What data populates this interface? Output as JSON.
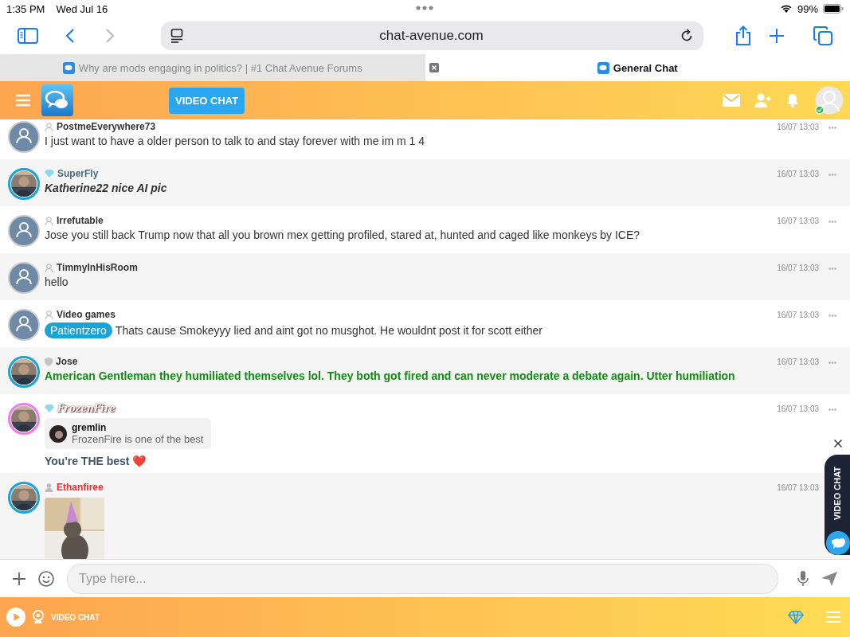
{
  "status_bar": {
    "time": "1:35 PM",
    "date": "Wed Jul 16",
    "battery": "99%"
  },
  "browser": {
    "address": "chat-avenue.com",
    "tabs": [
      {
        "title": "Why are mods engaging in politics? | #1 Chat Avenue Forums",
        "selected": false
      },
      {
        "title": "General Chat",
        "selected": true
      }
    ]
  },
  "header": {
    "video_button": "VIDEO CHAT"
  },
  "messages": [
    {
      "badge": {
        "kind": "user"
      },
      "author": {
        "name": "PostmeEverywhere73",
        "kind": "plain"
      },
      "avatar": {
        "kind": "default"
      },
      "body": {
        "kind": "plain",
        "text": "I just want to have a older person to talk to and stay forever with me im m 1 4"
      },
      "time": "16/07 13:03"
    },
    {
      "badge": {
        "kind": "diamond"
      },
      "author": {
        "name": "SuperFly",
        "kind": "accent"
      },
      "body": {
        "kind": "italic",
        "text": "Katherine22 nice AI pic"
      },
      "time": "16/07 13:03"
    },
    {
      "badge": {
        "kind": "user"
      },
      "author": {
        "name": "Irrefutable",
        "kind": "plain"
      },
      "avatar": {
        "kind": "default"
      },
      "body": {
        "kind": "plain",
        "text": "Jose you still back Trump now that all you brown mex getting profiled, stared at, hunted and caged like monkeys by ICE?"
      },
      "time": "16/07 13:03"
    },
    {
      "badge": {
        "kind": "user"
      },
      "author": {
        "name": "TimmyInHisRoom",
        "kind": "plain"
      },
      "avatar": {
        "kind": "default"
      },
      "body": {
        "kind": "plain",
        "text": "hello"
      },
      "time": "16/07 13:03"
    },
    {
      "badge": {
        "kind": "user"
      },
      "author": {
        "name": "Video games",
        "kind": "plain"
      },
      "avatar": {
        "kind": "default"
      },
      "mention": "Patientzero",
      "body": {
        "kind": "plain",
        "text": "Thats cause Smokeyyy lied and aint got no musghot. He wouldnt post it for scott either"
      },
      "time": "16/07 13:03"
    },
    {
      "badge": {
        "kind": "shield"
      },
      "author": {
        "name": "Jose",
        "kind": "plain"
      },
      "body": {
        "kind": "green",
        "text": "American Gentleman they humiliated themselves lol. They both got fired and can never moderate a debate again. Utter humiliation"
      },
      "time": "16/07 13:03"
    },
    {
      "badge": {
        "kind": "diamond"
      },
      "author": {
        "name": "FrozenFire",
        "kind": "fancy"
      },
      "quote": {
        "name": "gremlin",
        "text": "FrozenFire is one of the best"
      },
      "body": {
        "kind": "accent",
        "text": "You're THE best ❤️"
      },
      "time": "16/07 13:03"
    },
    {
      "badge": {
        "kind": "person"
      },
      "author": {
        "name": "Ethanfiree",
        "kind": "red"
      },
      "time": "16/07 13:03"
    }
  ],
  "side_tab": {
    "label": "VIDEO CHAT"
  },
  "composer": {
    "placeholder": "Type here..."
  },
  "footer": {
    "video_chat": "VIDEO CHAT"
  }
}
